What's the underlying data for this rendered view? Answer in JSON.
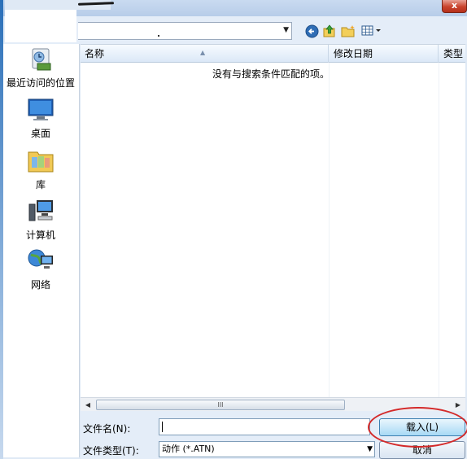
{
  "window": {
    "close_label": "x"
  },
  "sidebar": {
    "items": [
      {
        "label": "最近访问的位置",
        "icon": "recent-places-icon"
      },
      {
        "label": "桌面",
        "icon": "desktop-icon"
      },
      {
        "label": "库",
        "icon": "library-icon"
      },
      {
        "label": "计算机",
        "icon": "computer-icon"
      },
      {
        "label": "网络",
        "icon": "network-icon"
      }
    ]
  },
  "toolbar": {
    "icons": [
      "back-icon",
      "up-folder-icon",
      "new-folder-icon",
      "view-menu-icon"
    ]
  },
  "filelist": {
    "columns": [
      "名称",
      "修改日期",
      "类型"
    ],
    "empty_message": "没有与搜索条件匹配的项。"
  },
  "scrollbar": {
    "left_arrow": "◀",
    "right_arrow": "▶",
    "grip": "III"
  },
  "form": {
    "filename_label": "文件名(N):",
    "filename_value": "",
    "filetype_label": "文件类型(T):",
    "filetype_value": "动作 (*.ATN)",
    "open_label": "载入(L)",
    "cancel_label": "取消"
  },
  "colors": {
    "annotation_circle": "#d42a2a",
    "sidebar_bg": "#ffffff",
    "chrome_bg": "#e4edf8"
  }
}
